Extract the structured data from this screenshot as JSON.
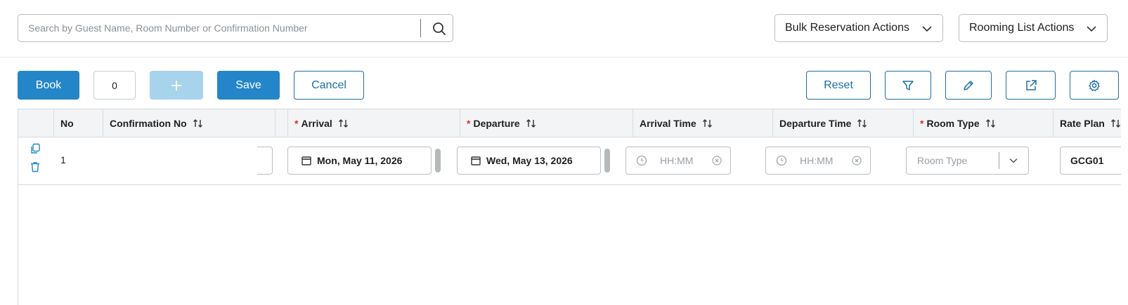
{
  "search": {
    "placeholder": "Search by Guest Name, Room Number or Confirmation Number",
    "value": ""
  },
  "header_actions": {
    "bulk_label": "Bulk Reservation Actions",
    "rooming_label": "Rooming List Actions"
  },
  "toolbar": {
    "book_label": "Book",
    "count_value": "0",
    "save_label": "Save",
    "cancel_label": "Cancel",
    "reset_label": "Reset"
  },
  "icons": {
    "search": "search-icon",
    "chevron": "chevron-down-icon",
    "add": "plus-icon",
    "filter": "filter-icon",
    "edit": "pencil-icon",
    "open": "external-link-icon",
    "settings": "gear-icon",
    "copy": "copy-icon",
    "delete": "trash-icon",
    "calendar": "calendar-icon",
    "clock": "clock-icon",
    "clear": "clear-icon",
    "sort": "sort-icon"
  },
  "grid": {
    "columns": {
      "no": "No",
      "confirmation": "Confirmation No",
      "arrival": "Arrival",
      "departure": "Departure",
      "arrival_time": "Arrival Time",
      "departure_time": "Departure Time",
      "room_type": "Room Type",
      "rate_plan": "Rate Plan"
    },
    "rows": [
      {
        "no": "1",
        "confirmation": "",
        "arrival": "Mon, May 11, 2026",
        "departure": "Wed, May 13, 2026",
        "arrival_time_placeholder": "HH:MM",
        "departure_time_placeholder": "HH:MM",
        "room_type_placeholder": "Room Type",
        "rate_plan": "GCG01"
      }
    ]
  },
  "colors": {
    "primary": "#2486c8",
    "primary_disabled": "#a8d3ec",
    "outline": "#1d6fa3",
    "required": "#d9352e"
  }
}
